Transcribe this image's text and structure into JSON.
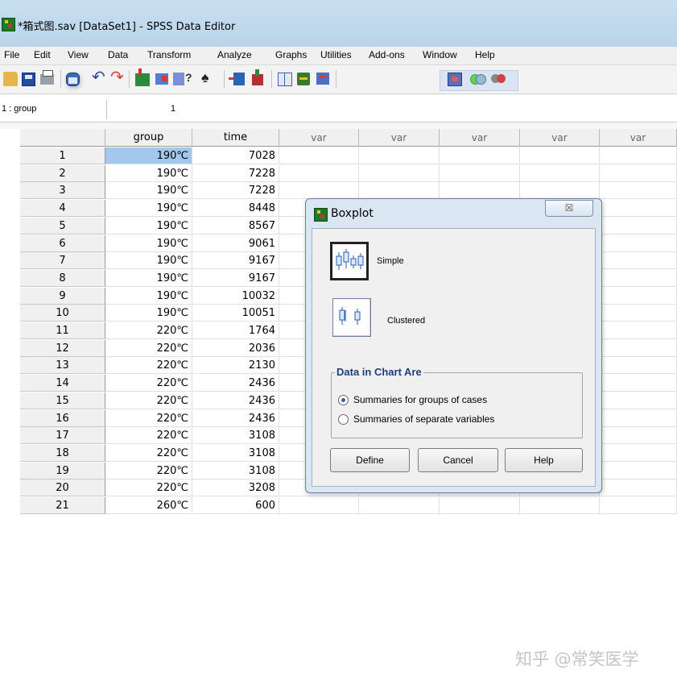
{
  "window": {
    "title": "*箱式图.sav [DataSet1] - SPSS Data Editor"
  },
  "menu": {
    "items": [
      "File",
      "Edit",
      "View",
      "Data",
      "Transform",
      "Analyze",
      "Graphs",
      "Utilities",
      "Add-ons",
      "Window",
      "Help"
    ]
  },
  "toolbar": {
    "icons": [
      "open-folder-icon",
      "save-icon",
      "print-icon",
      "dialog-recall-icon",
      "undo-icon",
      "redo-icon",
      "goto-case-icon",
      "variables-icon",
      "info-icon",
      "find-icon",
      "insert-cases-icon",
      "insert-variable-icon",
      "split-file-icon",
      "weight-cases-icon",
      "select-cases-icon",
      "value-labels-icon",
      "use-sets-icon",
      "show-all-variables-icon"
    ]
  },
  "cell_editor": {
    "reference": "1 : group",
    "value": "1"
  },
  "grid": {
    "columns": [
      "group",
      "time",
      "var",
      "var",
      "var",
      "var",
      "var"
    ],
    "rows": [
      {
        "n": "1",
        "group": "190℃",
        "time": "7028"
      },
      {
        "n": "2",
        "group": "190℃",
        "time": "7228"
      },
      {
        "n": "3",
        "group": "190℃",
        "time": "7228"
      },
      {
        "n": "4",
        "group": "190℃",
        "time": "8448"
      },
      {
        "n": "5",
        "group": "190℃",
        "time": "8567"
      },
      {
        "n": "6",
        "group": "190℃",
        "time": "9061"
      },
      {
        "n": "7",
        "group": "190℃",
        "time": "9167"
      },
      {
        "n": "8",
        "group": "190℃",
        "time": "9167"
      },
      {
        "n": "9",
        "group": "190℃",
        "time": "10032"
      },
      {
        "n": "10",
        "group": "190℃",
        "time": "10051"
      },
      {
        "n": "11",
        "group": "220℃",
        "time": "1764"
      },
      {
        "n": "12",
        "group": "220℃",
        "time": "2036"
      },
      {
        "n": "13",
        "group": "220℃",
        "time": "2130"
      },
      {
        "n": "14",
        "group": "220℃",
        "time": "2436"
      },
      {
        "n": "15",
        "group": "220℃",
        "time": "2436"
      },
      {
        "n": "16",
        "group": "220℃",
        "time": "2436"
      },
      {
        "n": "17",
        "group": "220℃",
        "time": "3108"
      },
      {
        "n": "18",
        "group": "220℃",
        "time": "3108"
      },
      {
        "n": "19",
        "group": "220℃",
        "time": "3108"
      },
      {
        "n": "20",
        "group": "220℃",
        "time": "3208"
      },
      {
        "n": "21",
        "group": "260℃",
        "time": "600"
      }
    ]
  },
  "dialog": {
    "title": "Boxplot",
    "close_glyph": "☒",
    "chart_types": [
      {
        "label": "Simple",
        "selected": true
      },
      {
        "label": "Clustered",
        "selected": false
      }
    ],
    "group_title": "Data in Chart Are",
    "options": [
      {
        "label": "Summaries for groups of cases",
        "checked": true
      },
      {
        "label": "Summaries of separate variables",
        "checked": false
      }
    ],
    "buttons": [
      "Define",
      "Cancel",
      "Help"
    ]
  },
  "watermark": "知乎 @常笑医学",
  "colors": {
    "selected_cell": "#a4c8ec",
    "title_bar": "#c9dfef",
    "dialog_frame": "#dbe6f3",
    "accent_blue": "#1f3d7a"
  }
}
